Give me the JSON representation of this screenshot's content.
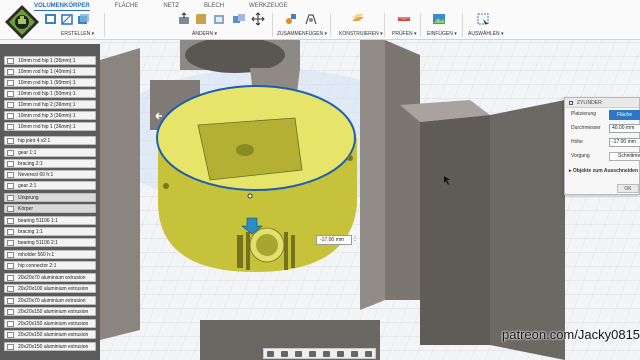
{
  "toolbar": {
    "tabs": [
      "VOLUMENKÖRPER",
      "FLÄCHE",
      "NETZ",
      "BLECH",
      "WERKZEUGE"
    ],
    "groups": {
      "create": "ERSTELLEN ▾",
      "modify": "ÄNDERN ▾",
      "assemble": "ZUSAMMENFÜGEN ▾",
      "construct": "KONSTRUIEREN ▾",
      "inspect": "PRÜFEN ▾",
      "insert": "EINFÜGEN ▾",
      "select": "AUSWÄHLEN ▾"
    }
  },
  "browser": {
    "items": [
      "10mm rod hip 1 (35mm):1",
      "10mm rod hip 1 (40mm):1",
      "10mm rod hip 1 (90mm):1",
      "10mm rod hip 1 (50mm):1",
      "10mm rod hip 2 (36mm):1",
      "10mm rod hip 3 (36mm):1",
      "10mm rod hip 1 (36mm):1",
      "hip joint 4 v2:1",
      "gear 1:1",
      "bracing 2:1",
      "Neverest 60 h:1",
      "gear 2:1",
      "Ursprung",
      "Körper",
      "bearing 51106 1:1",
      "bracing 1:1",
      "bearing 51106 2:1",
      "mholder 560 h:1",
      "hip connector 2:1",
      "20x20x70 aluminium extrusion",
      "20x20x100 aluminium extrusion",
      "20x20x70 aluminium extrusion",
      "20x20x150 aluminium extrusion",
      "20x20x150 aluminium extrusion",
      "20x20x150 aluminium extrusion",
      "20x20x150 aluminium extrusion"
    ]
  },
  "viewport": {
    "dimension_value": "-17.00 mm"
  },
  "dialog": {
    "title": "ZYLINDER",
    "placement_label": "Platzierung",
    "placement_value": "Fläche",
    "diameter_label": "Durchmesser",
    "diameter_value": "40.00 mm",
    "height_label": "Höhe",
    "height_value": "-17.00 mm",
    "operation_label": "Vorgang",
    "operation_value": "Schnittmenge",
    "subsection": "Objekte zum Ausschneiden",
    "ok": "OK"
  },
  "watermark": "patreon.com/Jacky0815",
  "colors": {
    "accent": "#2a77c7",
    "selection_yellow": "#e4e35a",
    "body_gray": "#9e9892"
  }
}
